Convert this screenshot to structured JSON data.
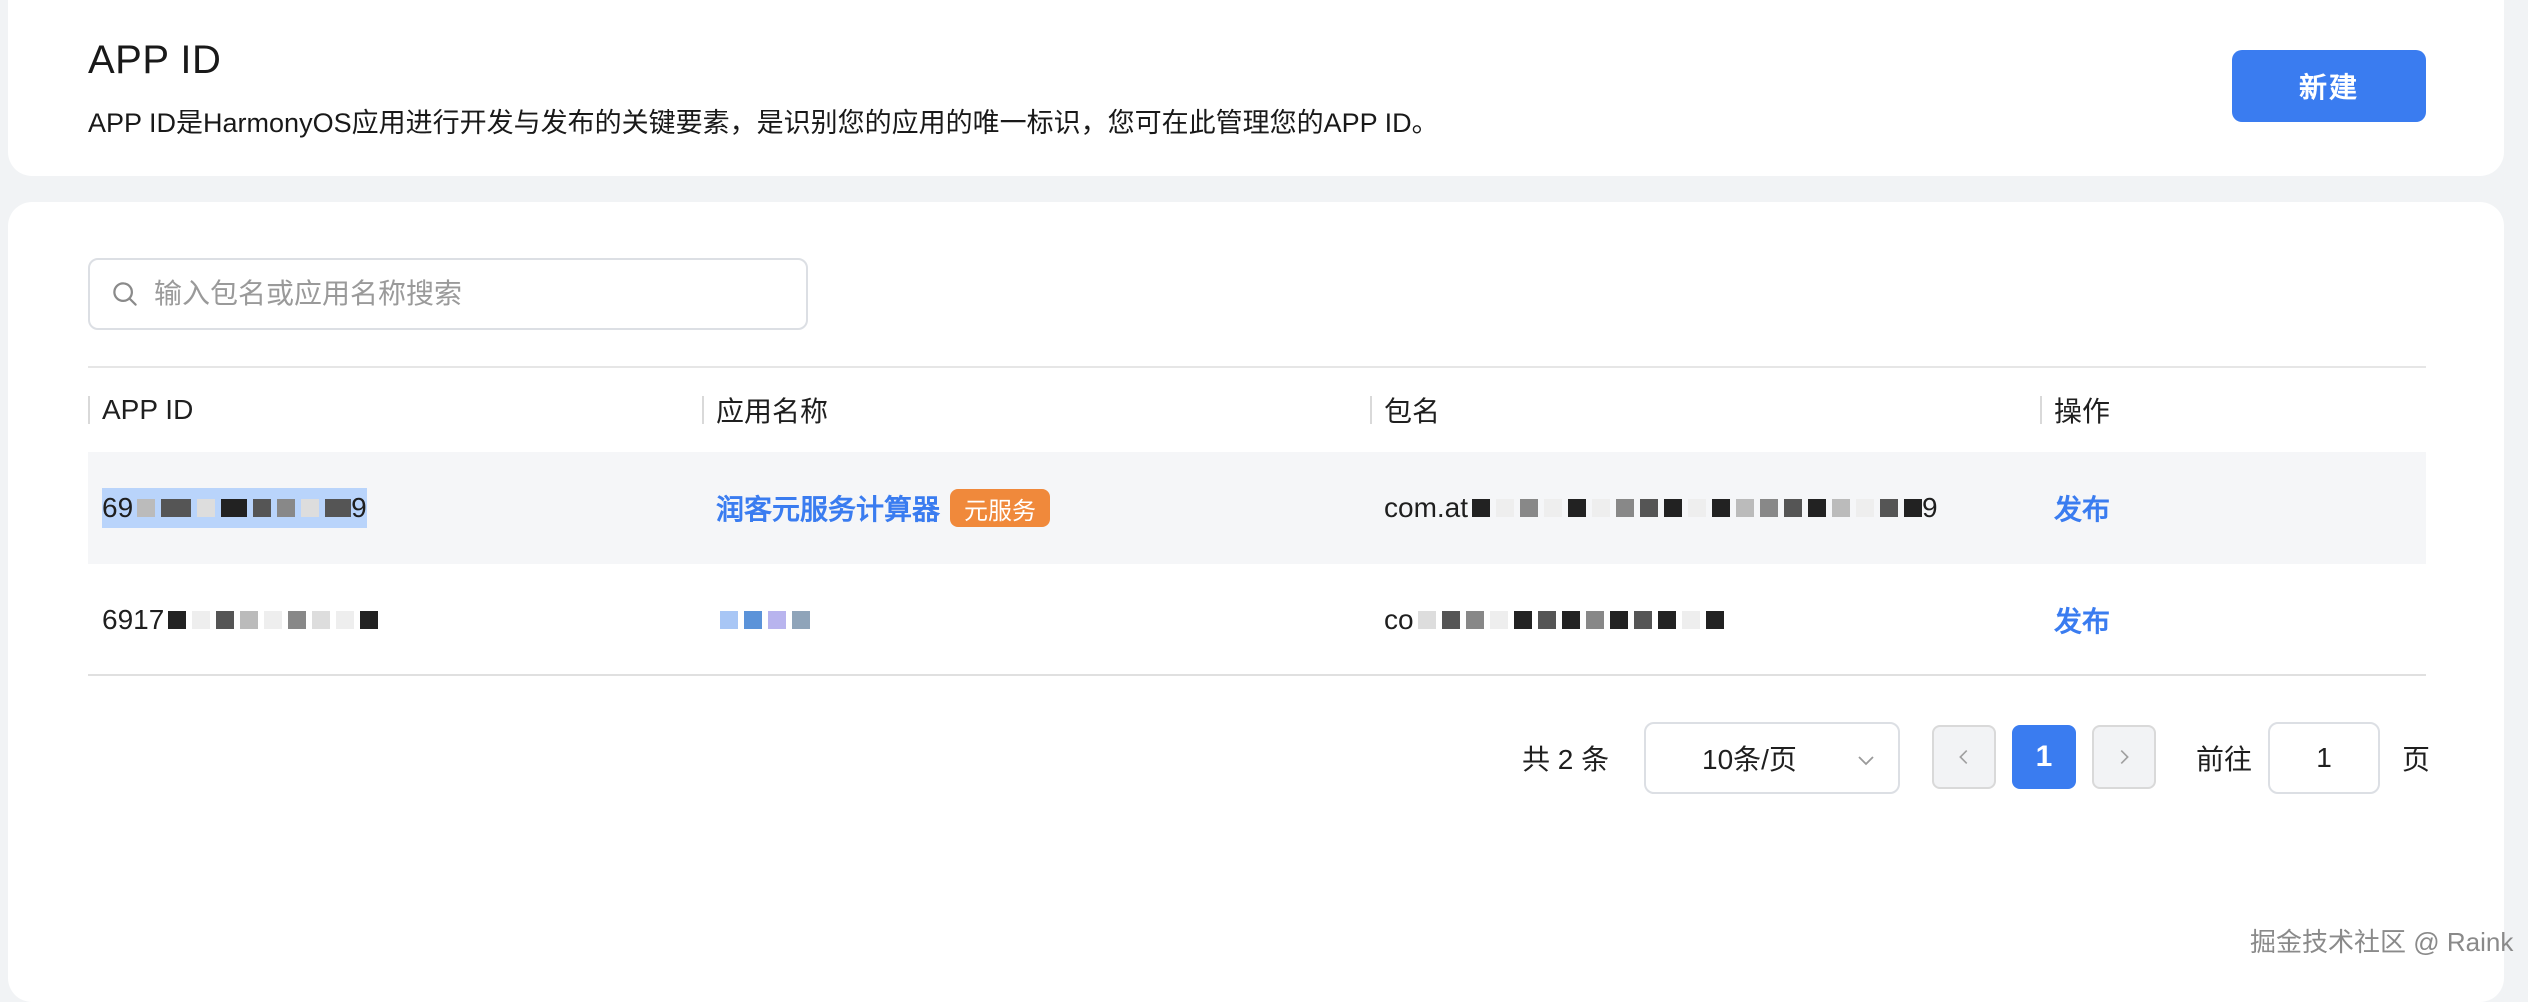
{
  "header": {
    "title": "APP ID",
    "description": "APP ID是HarmonyOS应用进行开发与发布的关键要素，是识别您的应用的唯一标识，您可在此管理您的APP ID。",
    "new_button": "新建"
  },
  "search": {
    "placeholder": "输入包名或应用名称搜索",
    "value": ""
  },
  "table": {
    "columns": [
      "APP ID",
      "应用名称",
      "包名",
      "操作"
    ],
    "rows": [
      {
        "app_id": "69",
        "app_id_tail": "9",
        "app_name": "润客元服务计算器",
        "tag": "元服务",
        "package": "com.at",
        "package_tail": "9",
        "action": "发布"
      },
      {
        "app_id": "6917",
        "app_name": "",
        "package": "co",
        "action": "发布"
      }
    ]
  },
  "pagination": {
    "total_text": "共 2 条",
    "page_size": "10条/页",
    "current_page": "1",
    "goto_label": "前往",
    "goto_value": "1",
    "goto_suffix": "页"
  },
  "watermark": "掘金技术社区 @ Raink",
  "colors": {
    "primary": "#3a7cf0",
    "tag": "#f0893b",
    "selection": "#b9d4fb"
  }
}
